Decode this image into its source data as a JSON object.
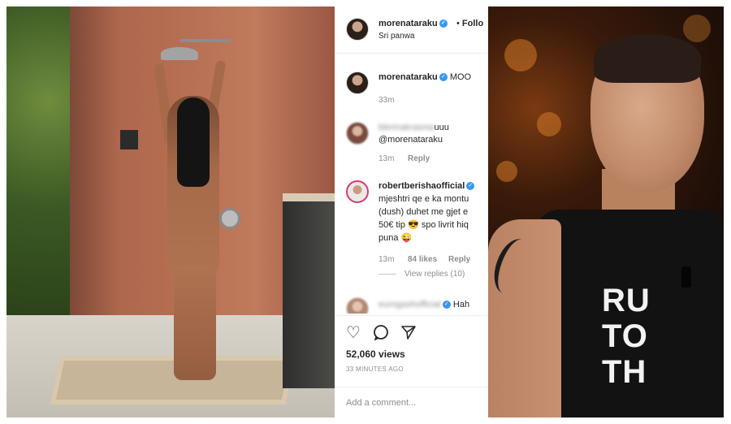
{
  "post": {
    "username": "morenataraku",
    "follow_label": "Follo",
    "location": "Sri panwa"
  },
  "comments": [
    {
      "username": "morenataraku",
      "text": "MOO",
      "time": "33m"
    },
    {
      "text_visible": "uuu",
      "mention": "@morenataraku",
      "time": "13m",
      "reply_label": "Reply"
    },
    {
      "username": "robertberishaofficial",
      "lines": [
        "mjeshtri qe e ka montu",
        "(dush) duhet me gjet e",
        "50€ tip 😎 spo livrit hiq",
        "puna 😜"
      ],
      "time": "13m",
      "likes": "84 likes",
      "reply_label": "Reply",
      "view_replies": "View replies (10)"
    },
    {
      "text_visible": "Hah"
    }
  ],
  "actions": {
    "like_icon": "heart-icon",
    "comment_icon": "comment-icon",
    "share_icon": "share-icon"
  },
  "views": "52,060 views",
  "time_ago": "33 MINUTES AGO",
  "add_comment": {
    "placeholder": "Add a comment..."
  },
  "right_photo": {
    "shirt_text": "RU\nTO\nTH"
  }
}
